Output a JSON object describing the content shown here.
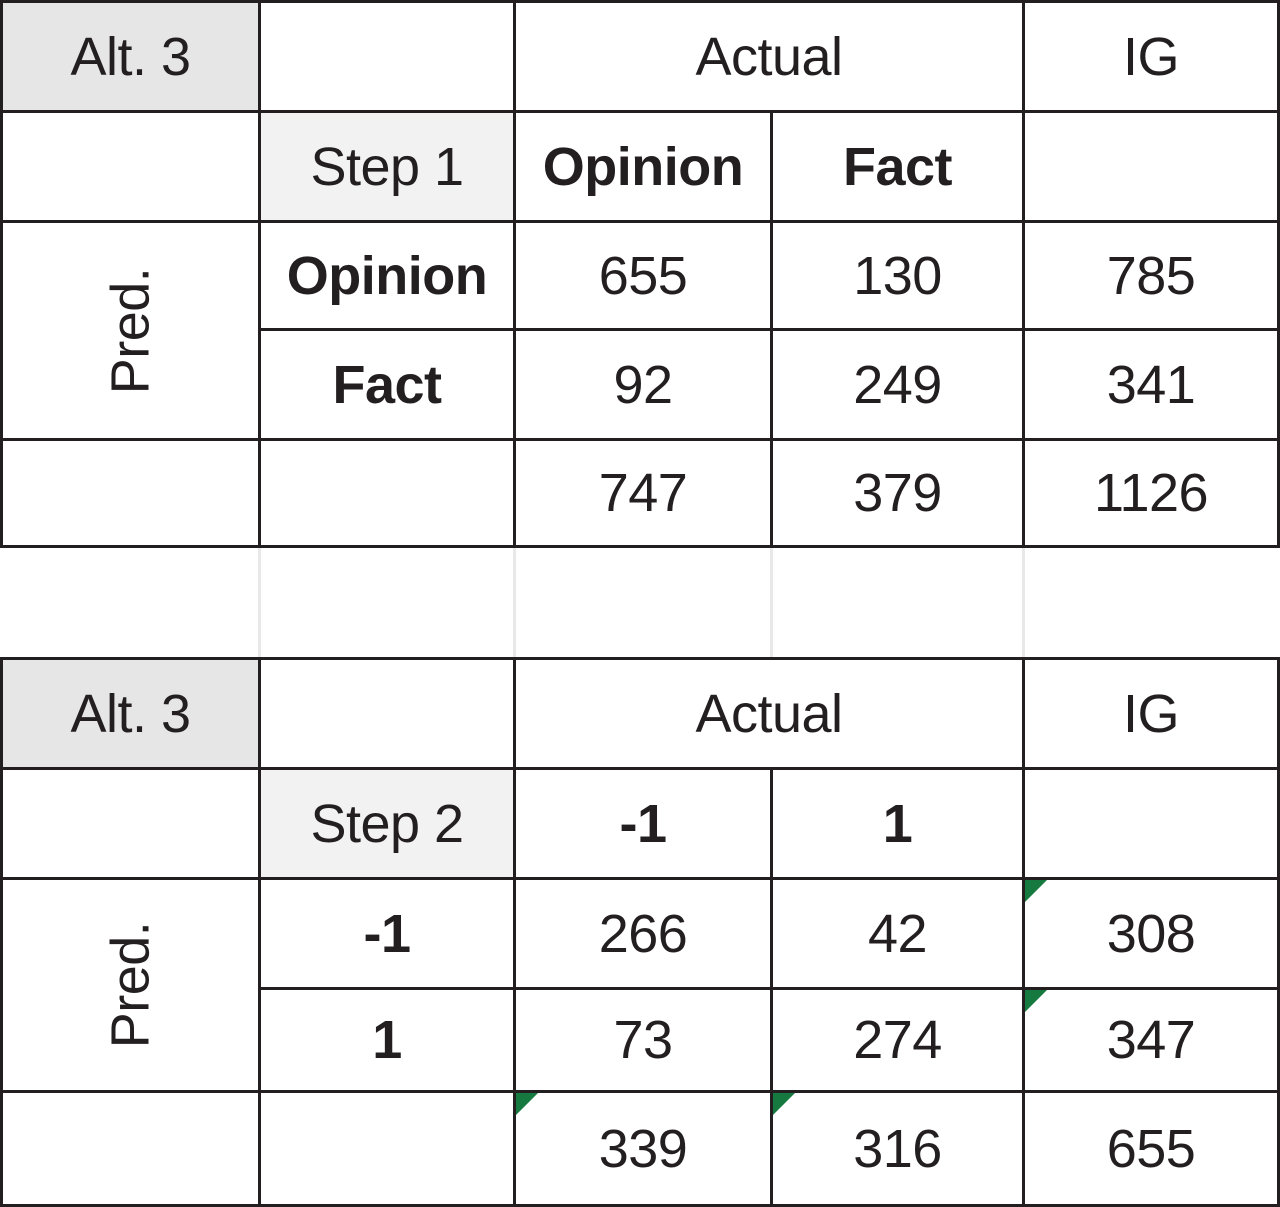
{
  "tables": [
    {
      "name": "step-1-confusion-matrix",
      "corner_label": "Alt. 3",
      "actual_header": "Actual",
      "ig_header": "IG",
      "step_label": "Step 1",
      "pred_label": "Pred.",
      "class_headers": [
        "Opinion",
        "Fact"
      ],
      "row_labels": [
        "Opinion",
        "Fact"
      ],
      "rows": [
        {
          "label": "Opinion",
          "values": [
            "655",
            "130"
          ],
          "total": "785"
        },
        {
          "label": "Fact",
          "values": [
            "92",
            "249"
          ],
          "total": "341"
        }
      ],
      "column_totals": [
        "747",
        "379"
      ],
      "grand_total": "1126",
      "flags": []
    },
    {
      "name": "step-2-confusion-matrix",
      "corner_label": "Alt. 3",
      "actual_header": "Actual",
      "ig_header": "IG",
      "step_label": "Step 2",
      "pred_label": "Pred.",
      "class_headers": [
        "-1",
        "1"
      ],
      "row_labels": [
        "-1",
        "1"
      ],
      "rows": [
        {
          "label": "-1",
          "values": [
            "266",
            "42"
          ],
          "total": "308"
        },
        {
          "label": "1",
          "values": [
            "73",
            "274"
          ],
          "total": "347"
        }
      ],
      "column_totals": [
        "339",
        "316"
      ],
      "grand_total": "655",
      "flags": [
        "row0-total",
        "row1-total",
        "coltotal0",
        "coltotal1"
      ]
    }
  ],
  "chart_data": {
    "type": "table",
    "title": "Alt. 3 confusion matrices",
    "matrices": [
      {
        "step": "Step 1",
        "axes": {
          "rows": "Pred.",
          "columns": "Actual",
          "margin": "IG"
        },
        "categories": [
          "Opinion",
          "Fact"
        ],
        "matrix": [
          [
            655,
            130
          ],
          [
            92,
            249
          ]
        ],
        "row_totals": [
          785,
          341
        ],
        "column_totals": [
          747,
          379
        ],
        "grand_total": 1126
      },
      {
        "step": "Step 2",
        "axes": {
          "rows": "Pred.",
          "columns": "Actual",
          "margin": "IG"
        },
        "categories": [
          "-1",
          "1"
        ],
        "matrix": [
          [
            266,
            42
          ],
          [
            73,
            274
          ]
        ],
        "row_totals": [
          308,
          347
        ],
        "column_totals": [
          339,
          316
        ],
        "grand_total": 655
      }
    ]
  },
  "colors": {
    "grid": "#231f20",
    "corner_shade": "#e6e6e6",
    "step_shade": "#f2f2f2",
    "error_flag_green": "#16793f",
    "gap_rule": "#e8e8e8"
  }
}
